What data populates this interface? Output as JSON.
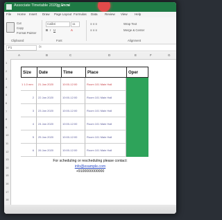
{
  "window": {
    "title": "Associate Timetable 2020 - Excel",
    "quick_access": "⊞  ↶  ↷",
    "accent": "#1f7a45"
  },
  "menu": [
    "File",
    "Home",
    "Insert",
    "Draw",
    "Page Layout",
    "Formulas",
    "Data",
    "Review",
    "View",
    "Help"
  ],
  "ribbon": {
    "clipboard": [
      "Cut",
      "Copy",
      "Format Painter"
    ],
    "clipboard_group": "Clipboard",
    "font_name": "Calibri",
    "font_size": "11",
    "font_group": "Font",
    "alignment_group": "Alignment",
    "wrap_text": "Wrap Text",
    "merge_center": "Merge & Center"
  },
  "formula_bar": {
    "name_box": "F1",
    "fx": "fx"
  },
  "columns": [
    "A",
    "B",
    "C",
    "D",
    "E",
    "F",
    "G"
  ],
  "rows": [
    "1",
    "2",
    "3",
    "4",
    "5",
    "6",
    "7",
    "8",
    "9",
    "10",
    "11",
    "12",
    "13",
    "14",
    "15",
    "16",
    "17",
    "18"
  ],
  "table": {
    "headers": [
      "Size",
      "Date",
      "Time",
      "Place",
      "Oper"
    ],
    "rows": [
      [
        "1 1.0 mm",
        "21 Jan 2020",
        "10:00-12:00",
        "Room 101 Main Hall",
        ""
      ],
      [
        "2",
        "22 Jan 2020",
        "10:00-12:00",
        "Room 101 Main Hall",
        ""
      ],
      [
        "3",
        "23 Jan 2020",
        "10:00-12:00",
        "Room 101 Main Hall",
        ""
      ],
      [
        "4",
        "24 Jan 2020",
        "10:00-12:00",
        "Room 101 Main Hall",
        ""
      ],
      [
        "5",
        "25 Jan 2020",
        "10:00-12:00",
        "Room 101 Main Hall",
        ""
      ],
      [
        "6",
        "26 Jan 2020",
        "10:00-12:00",
        "Room 101 Main Hall",
        ""
      ]
    ],
    "oper_color": "#2ea35a"
  },
  "footer": {
    "note": "For scheduling or rescheduling please contact:",
    "email": "info@example.com",
    "phone": "+9100000000000"
  }
}
